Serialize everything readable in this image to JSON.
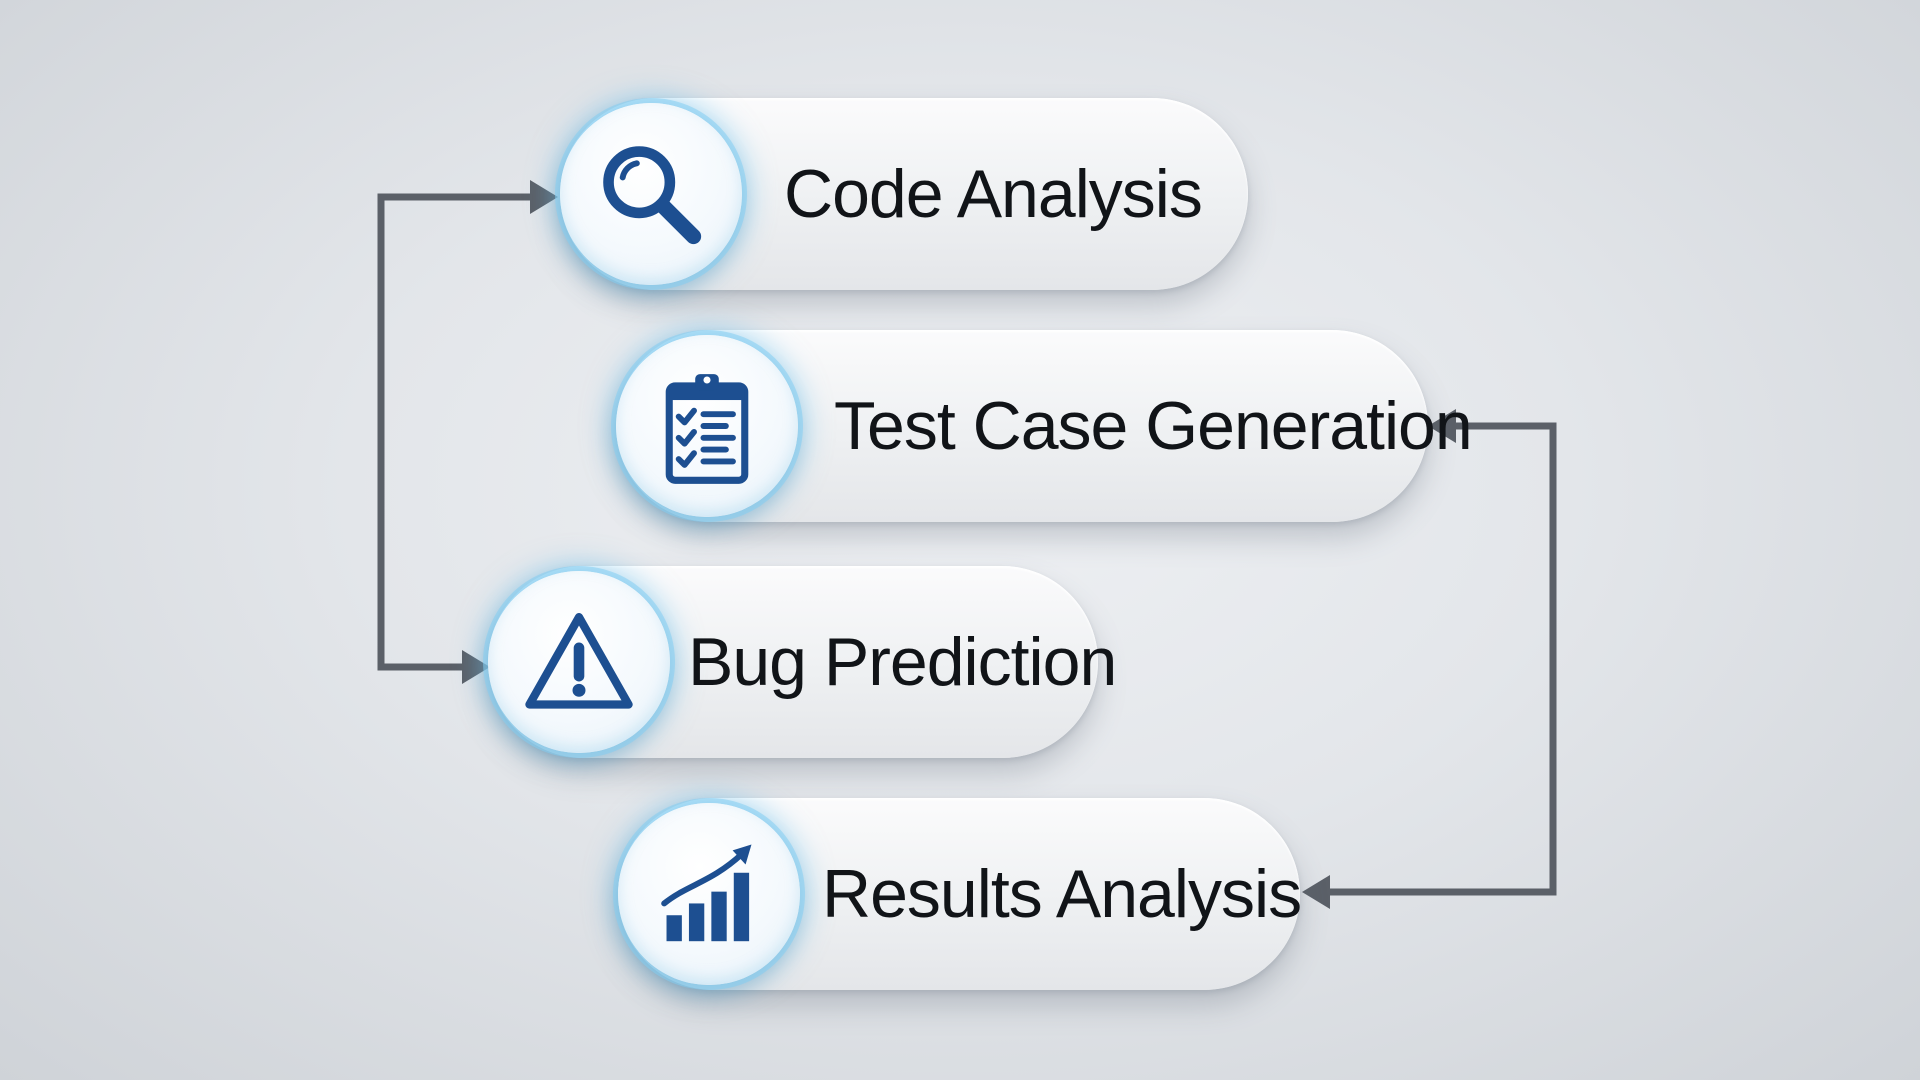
{
  "diagram": {
    "steps": [
      {
        "id": "code-analysis",
        "label": "Code Analysis",
        "icon": "magnifying-glass-icon"
      },
      {
        "id": "test-case-generation",
        "label": "Test Case Generation",
        "icon": "clipboard-checklist-icon"
      },
      {
        "id": "bug-prediction",
        "label": "Bug Prediction",
        "icon": "warning-triangle-icon"
      },
      {
        "id": "results-analysis",
        "label": "Results Analysis",
        "icon": "bar-chart-trend-icon"
      }
    ],
    "connections": [
      {
        "from": "bug-prediction",
        "to": "code-analysis"
      },
      {
        "from": "code-analysis",
        "to": "bug-prediction"
      },
      {
        "from": "results-analysis",
        "to": "test-case-generation"
      },
      {
        "from": "test-case-generation",
        "to": "results-analysis"
      }
    ],
    "colors": {
      "icon": "#1d4f91",
      "connector": "#5b6068",
      "glow": "#84cef2",
      "text": "#111418"
    }
  }
}
